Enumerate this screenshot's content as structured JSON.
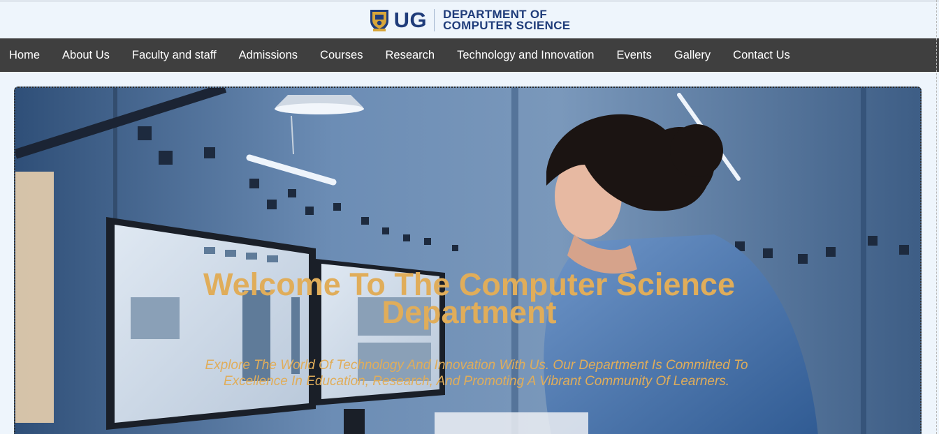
{
  "logo": {
    "brand": "UG",
    "department_line1": "DEPARTMENT OF",
    "department_line2": "COMPUTER SCIENCE"
  },
  "nav": {
    "items": [
      {
        "label": "Home"
      },
      {
        "label": "About Us"
      },
      {
        "label": "Faculty and staff"
      },
      {
        "label": "Admissions"
      },
      {
        "label": "Courses"
      },
      {
        "label": "Research"
      },
      {
        "label": "Technology and Innovation"
      },
      {
        "label": "Events"
      },
      {
        "label": "Gallery"
      },
      {
        "label": "Contact Us"
      }
    ]
  },
  "hero": {
    "title_line1": "Welcome To The Computer Science",
    "title_line2": "Department",
    "subtitle_line1": "Explore The World Of Technology And Innovation With Us. Our Department Is Committed To",
    "subtitle_line2": "Excellence In Education, Research, And Promoting A Vibrant Community Of Learners.",
    "image_icon": "woman-at-computer-photo"
  },
  "colors": {
    "brand_blue": "#1f3c7a",
    "nav_background": "#3f3f3f",
    "hero_text": "#e0ad5a",
    "page_background": "#eef5fc"
  }
}
